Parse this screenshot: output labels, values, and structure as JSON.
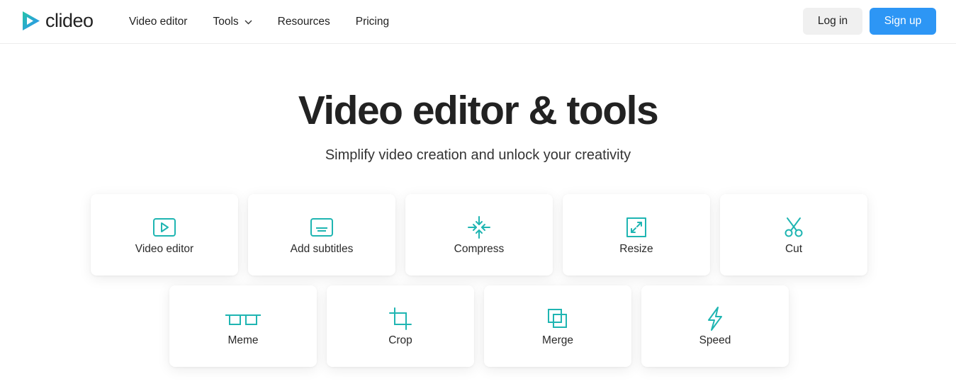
{
  "brand": {
    "name": "clideo",
    "accent": "#1fb5b2",
    "primary_blue": "#2d96f5"
  },
  "nav": {
    "items": [
      {
        "label": "Video editor"
      },
      {
        "label": "Tools",
        "has_dropdown": true
      },
      {
        "label": "Resources"
      },
      {
        "label": "Pricing"
      }
    ]
  },
  "auth": {
    "login_label": "Log in",
    "signup_label": "Sign up"
  },
  "hero": {
    "title": "Video editor & tools",
    "subtitle": "Simplify video creation and unlock your creativity"
  },
  "tools": [
    {
      "label": "Video editor",
      "icon": "play-screen-icon"
    },
    {
      "label": "Add subtitles",
      "icon": "subtitles-icon"
    },
    {
      "label": "Compress",
      "icon": "compress-icon"
    },
    {
      "label": "Resize",
      "icon": "resize-icon"
    },
    {
      "label": "Cut",
      "icon": "scissors-icon"
    },
    {
      "label": "Meme",
      "icon": "meme-glasses-icon"
    },
    {
      "label": "Crop",
      "icon": "crop-icon"
    },
    {
      "label": "Merge",
      "icon": "merge-icon"
    },
    {
      "label": "Speed",
      "icon": "lightning-icon"
    }
  ]
}
